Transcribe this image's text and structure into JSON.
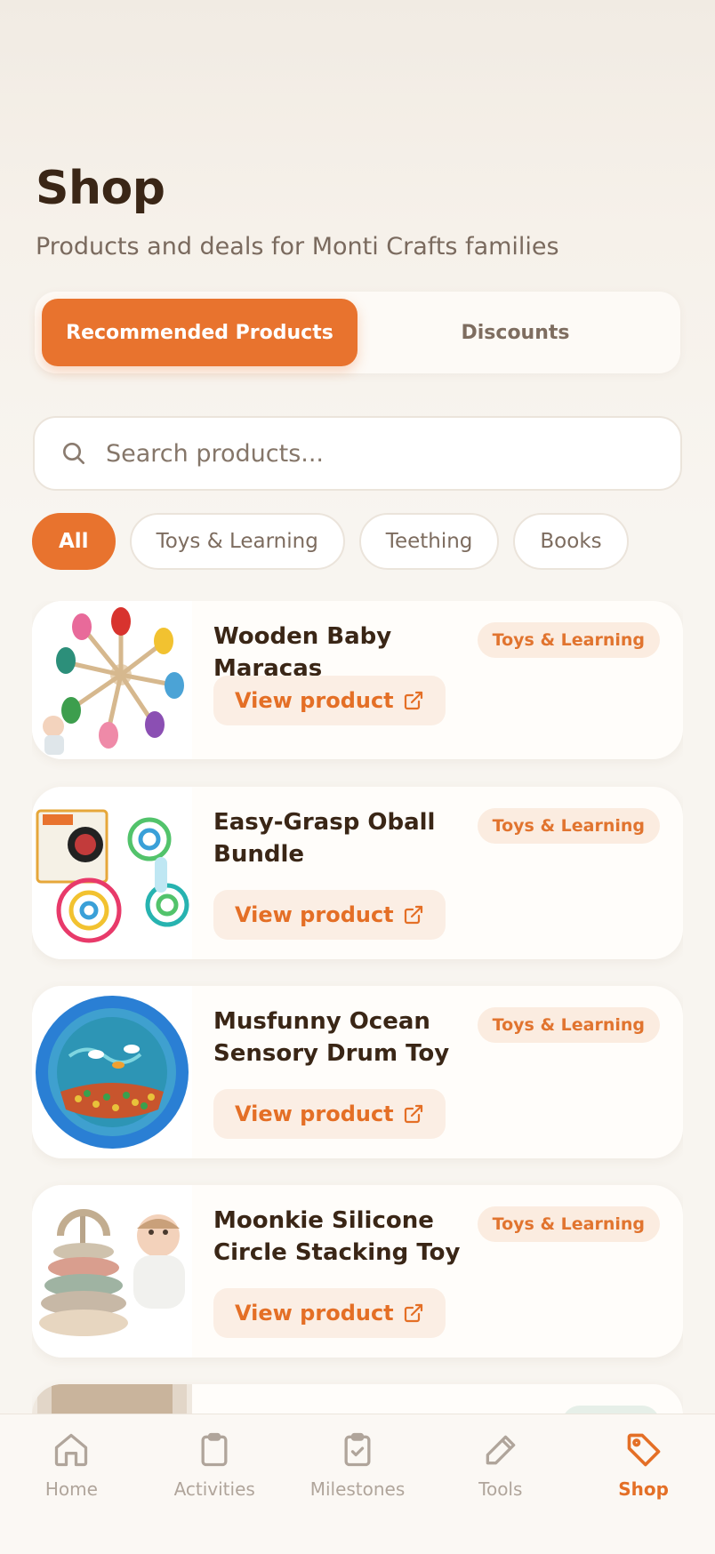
{
  "header": {
    "title": "Shop",
    "subtitle": "Products and deals for Monti Crafts families"
  },
  "segments": {
    "recommended_label": "Recommended Products",
    "discounts_label": "Discounts",
    "active": "recommended"
  },
  "search": {
    "placeholder": "Search products...",
    "value": ""
  },
  "filters": [
    {
      "label": "All",
      "active": true
    },
    {
      "label": "Toys & Learning",
      "active": false
    },
    {
      "label": "Teething",
      "active": false
    },
    {
      "label": "Books",
      "active": false
    }
  ],
  "products": [
    {
      "name": "Wooden Baby Maracas",
      "category": "Toys & Learning",
      "cta": "View product",
      "image": "maracas-image"
    },
    {
      "name": "Easy-Grasp Oball Bundle",
      "category": "Toys & Learning",
      "cta": "View product",
      "image": "oball-image"
    },
    {
      "name": "Musfunny Ocean Sensory Drum Toy",
      "category": "Toys & Learning",
      "cta": "View product",
      "image": "ocean-drum-image"
    },
    {
      "name": "Moonkie Silicone Circle Stacking Toy",
      "category": "Toys & Learning",
      "cta": "View product",
      "image": "stacking-toy-image"
    }
  ],
  "tabbar": {
    "home": "Home",
    "activities": "Activities",
    "milestones": "Milestones",
    "tools": "Tools",
    "shop": "Shop",
    "active": "shop"
  },
  "colors": {
    "accent": "#e8732e",
    "tag_bg": "#fbece0",
    "text_dark": "#3a2616",
    "text_muted": "#7a6a5e"
  }
}
